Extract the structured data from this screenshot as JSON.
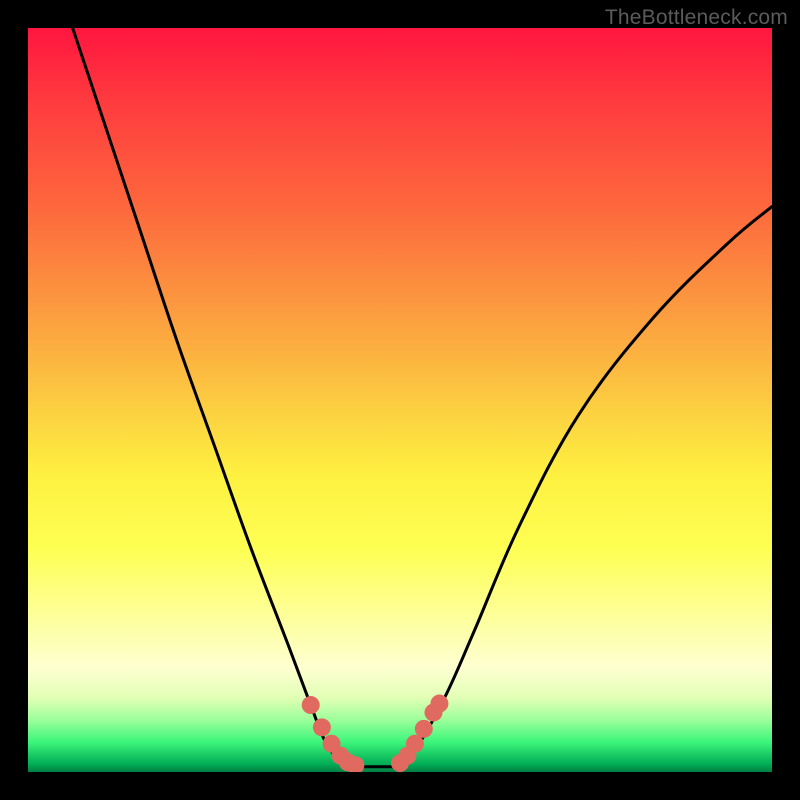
{
  "watermark": "TheBottleneck.com",
  "chart_data": {
    "type": "line",
    "title": "",
    "xlabel": "",
    "ylabel": "",
    "xlim": [
      0,
      100
    ],
    "ylim": [
      0,
      100
    ],
    "grid": false,
    "legend": false,
    "series": [
      {
        "name": "left-curve",
        "x": [
          6,
          10,
          15,
          20,
          25,
          30,
          35,
          38,
          40,
          42,
          44
        ],
        "y": [
          100,
          88,
          73,
          58,
          44,
          30,
          17,
          9,
          4,
          1.5,
          0.7
        ]
      },
      {
        "name": "valley-floor",
        "x": [
          44,
          49
        ],
        "y": [
          0.7,
          0.7
        ]
      },
      {
        "name": "right-curve",
        "x": [
          49,
          52,
          56,
          60,
          66,
          74,
          84,
          94,
          100
        ],
        "y": [
          0.7,
          3,
          10,
          19,
          33,
          48,
          61,
          71,
          76
        ]
      },
      {
        "name": "highlighted-points-left",
        "x": [
          38.0,
          39.5,
          40.8,
          42.0,
          43.0,
          44.0
        ],
        "y": [
          9.0,
          6.0,
          3.8,
          2.2,
          1.3,
          0.9
        ]
      },
      {
        "name": "highlighted-points-right",
        "x": [
          50.0,
          51.0,
          52.0,
          53.2,
          54.5,
          55.3
        ],
        "y": [
          1.2,
          2.2,
          3.8,
          5.8,
          8.0,
          9.2
        ]
      }
    ],
    "colors": {
      "curve": "#000000",
      "highlight": "#e16a60"
    }
  }
}
